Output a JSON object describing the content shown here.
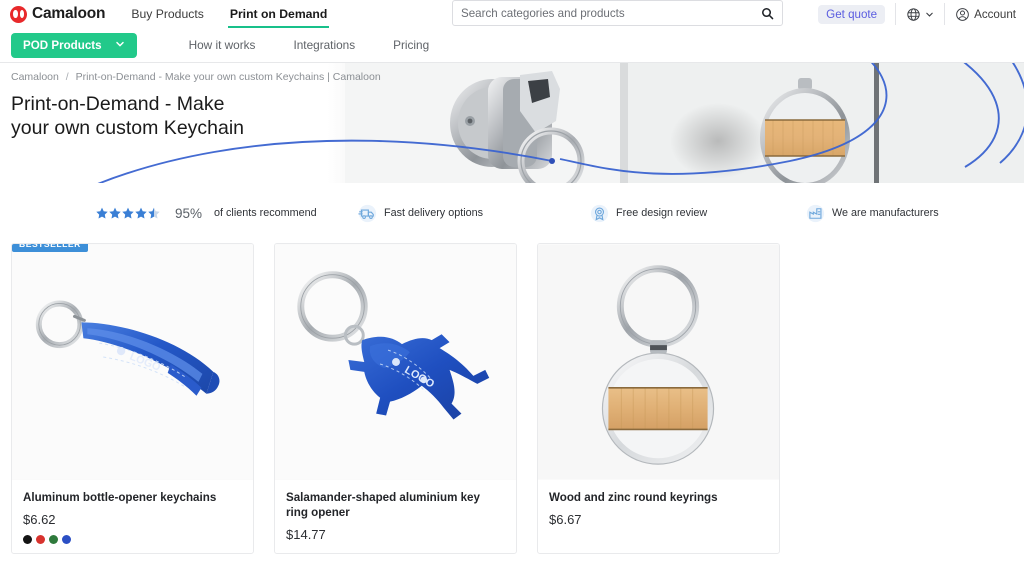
{
  "brand": {
    "name": "Camaloon",
    "logo_color": "#e8292b"
  },
  "header": {
    "nav": [
      {
        "label": "Buy Products",
        "active": false
      },
      {
        "label": "Print on Demand",
        "active": true
      }
    ],
    "search": {
      "placeholder": "Search categories and products",
      "value": "",
      "icon": "search-icon"
    },
    "quote_label": "Get quote",
    "language_icon": "globe-icon",
    "chevron_icon": "chevron-down-icon",
    "account_label": "Account",
    "account_icon": "user-circle-icon"
  },
  "subnav": {
    "pod_button": {
      "label": "POD Products",
      "icon": "chevron-down-icon",
      "color": "#22c98a"
    },
    "links": [
      {
        "label": "How it works"
      },
      {
        "label": "Integrations"
      },
      {
        "label": "Pricing"
      }
    ]
  },
  "hero": {
    "breadcrumb": {
      "root": "Camaloon",
      "separator": "/",
      "current": "Print-on-Demand - Make your own custom Keychains | Camaloon"
    },
    "title": "Print-on-Demand - Make\nyour own custom Keychain"
  },
  "badges": [
    {
      "icon": "stars-icon",
      "rating": "95%",
      "text": "of clients recommend",
      "stars_full": 4,
      "stars_half": 1
    },
    {
      "icon": "delivery-truck-icon",
      "text": "Fast delivery options"
    },
    {
      "icon": "design-review-badge-icon",
      "text": "Free design review"
    },
    {
      "icon": "factory-icon",
      "text": "We are manufacturers"
    }
  ],
  "products": [
    {
      "image": "blue-bottle-opener-keychain",
      "badge": "BESTSELLER",
      "title": "Aluminum bottle-opener keychains",
      "price": "$6.62",
      "swatches": [
        "#141414",
        "#d8332e",
        "#2f7a3c",
        "#2b4fc4"
      ]
    },
    {
      "image": "blue-salamander-keyring",
      "badge": "",
      "title": "Salamander-shaped aluminium key ring opener",
      "price": "$14.77",
      "swatches": []
    },
    {
      "image": "wood-zinc-round-keyring",
      "badge": "",
      "title": "Wood and zinc round keyrings",
      "price": "$6.67",
      "swatches": []
    }
  ],
  "colors": {
    "accent_green": "#22c98a",
    "badge_blue": "#3d8fd8",
    "quote_violet": "#5a5ce0",
    "star_blue": "#3a7fd5"
  }
}
